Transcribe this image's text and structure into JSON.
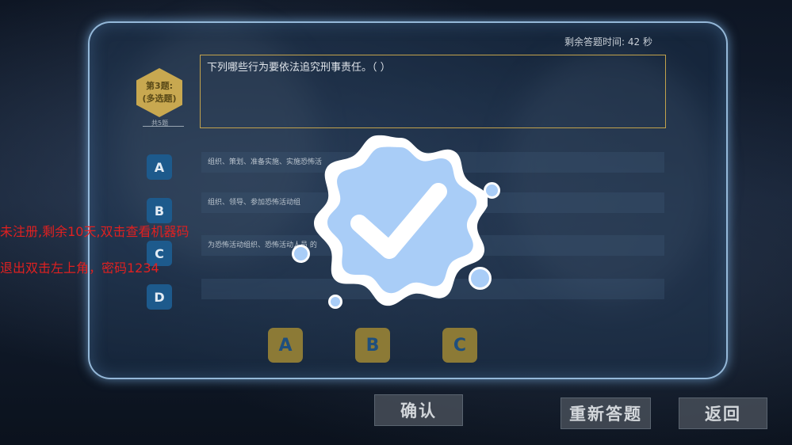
{
  "timer": {
    "label": "剩余答题时间:",
    "value": "42 秒"
  },
  "question": {
    "number_label": "第3题:",
    "type_label": "(多选题)",
    "total_label": "共5题",
    "text": "下列哪些行为要依法追究刑事责任。（    ）"
  },
  "options": [
    {
      "letter": "A",
      "text": "组织、策划、准备实施、实施恐怖活"
    },
    {
      "letter": "B",
      "text": "组织、领导、参加恐怖活动组"
    },
    {
      "letter": "C",
      "text": "为恐怖活动组织、恐怖活动人员                                                    的"
    },
    {
      "letter": "D",
      "text": ""
    }
  ],
  "selected_answers": [
    "A",
    "B",
    "C"
  ],
  "buttons": {
    "confirm": "确认",
    "retry": "重新答题",
    "back": "返回"
  },
  "registration_notice": {
    "line1": "未注册,剩余10天,双击查看机器码",
    "line2": "退出双击左上角，密码1234"
  },
  "colors": {
    "panel_border": "#aad2f5",
    "accent_gold": "#c8a850",
    "option_blue": "#1d5a8c",
    "check_badge": "#a9cdf7",
    "notice_red": "#e02020"
  },
  "icons": {
    "result": "checkmark-badge-icon"
  }
}
